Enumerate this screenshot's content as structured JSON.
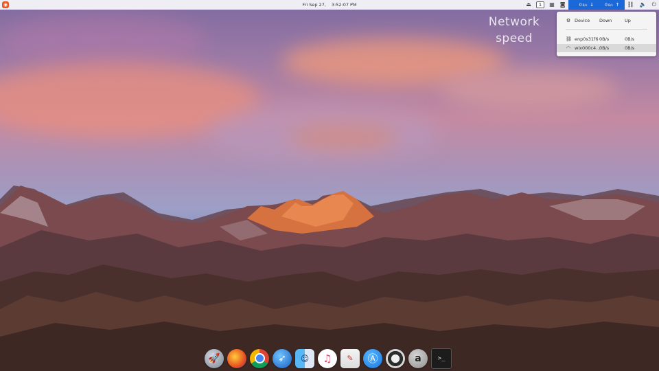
{
  "panel": {
    "logo_icon": "ubuntu-logo-icon",
    "clock": {
      "date": "Fri Sep 27,",
      "time": "3:52:07 PM"
    },
    "workspace_number": "1",
    "net_indicator": {
      "down_value": "0",
      "down_unit": "B/s",
      "up_value": "0",
      "up_unit": "B/s",
      "background": "#1b69d8"
    },
    "tray_icons": [
      "eject-icon",
      "workspace-indicator",
      "grid-icon",
      "screenshot-icon",
      "network-speed-indicator",
      "network-icon",
      "volume-icon",
      "power-icon"
    ]
  },
  "annotation": {
    "line1": "Network",
    "line2": "speed"
  },
  "popup": {
    "header": {
      "device": "Device",
      "down": "Down",
      "up": "Up"
    },
    "rows": [
      {
        "icon": "wired-network-icon",
        "device": "enp0s31f6",
        "down": "0B/s",
        "up": "0B/s",
        "active": false
      },
      {
        "icon": "wifi-icon",
        "device": "wlx000c4…",
        "down": "0B/s",
        "up": "0B/s",
        "active": true
      }
    ]
  },
  "dock": {
    "apps": [
      {
        "name": "launchpad-icon"
      },
      {
        "name": "firefox-icon"
      },
      {
        "name": "chrome-icon"
      },
      {
        "name": "bird-app-icon"
      },
      {
        "name": "finder-icon"
      },
      {
        "name": "music-icon"
      },
      {
        "name": "notes-icon"
      },
      {
        "name": "app-store-icon"
      },
      {
        "name": "settings-icon"
      },
      {
        "name": "amazon-icon",
        "glyph": "a"
      },
      {
        "name": "terminal-icon",
        "glyph": ">_"
      }
    ]
  },
  "colors": {
    "accent": "#1b69d8",
    "ubuntu": "#e95420",
    "panel_bg": "#fafafc"
  }
}
